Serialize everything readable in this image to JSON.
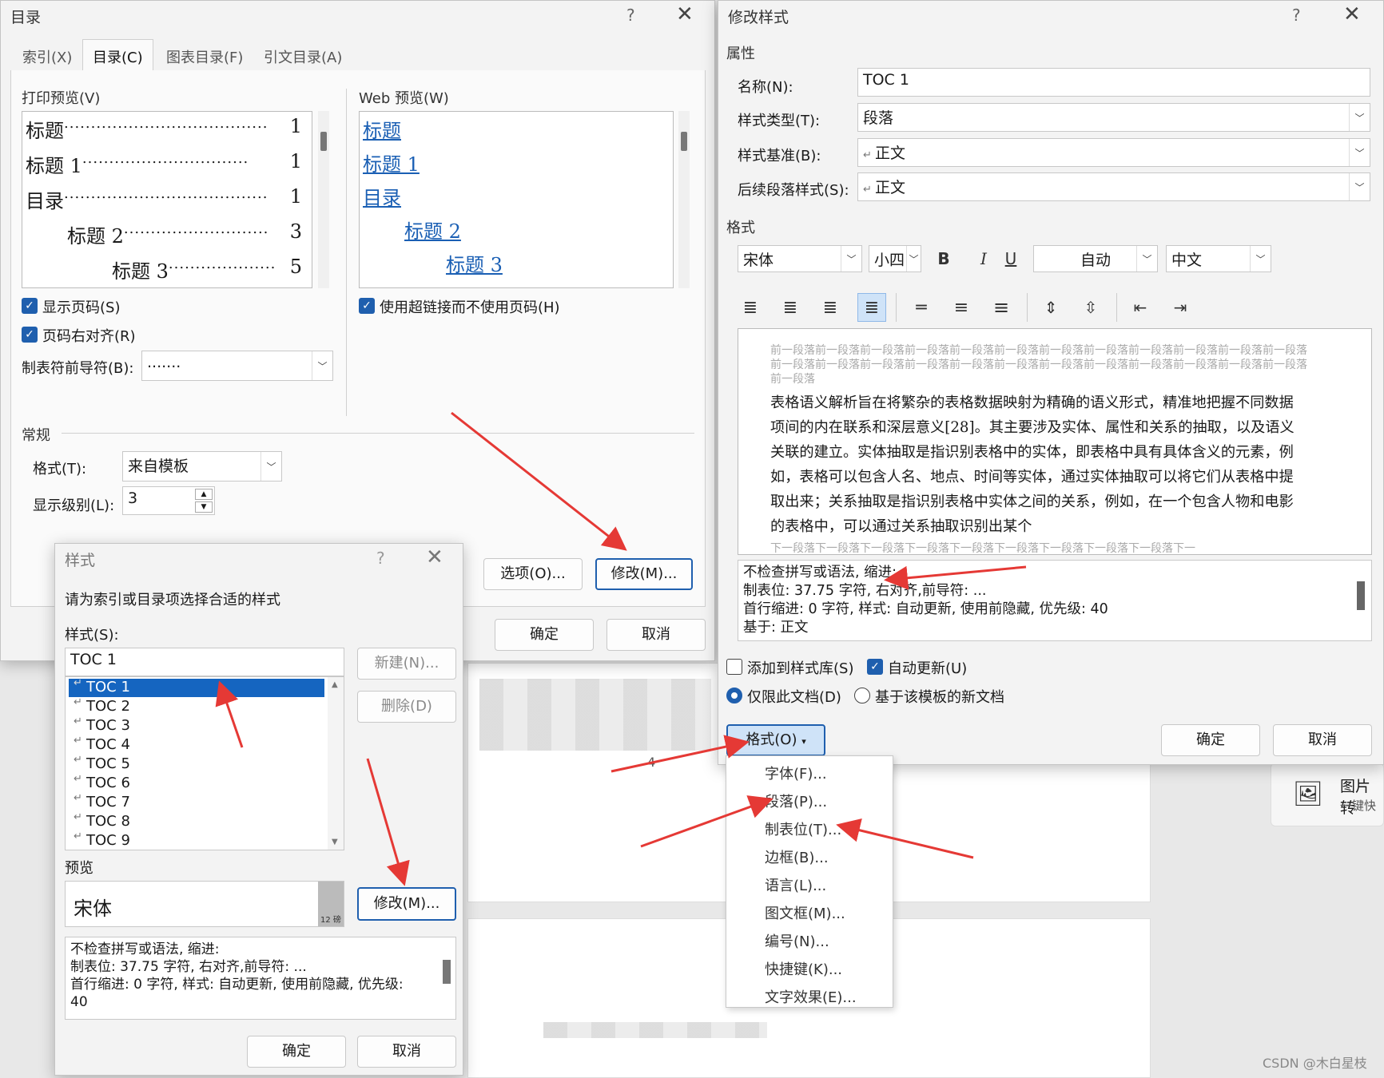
{
  "toc_dialog": {
    "title": "目录",
    "help": "?",
    "close": "✕",
    "tabs": [
      "索引(X)",
      "目录(C)",
      "图表目录(F)",
      "引文目录(A)"
    ],
    "print_preview_label": "打印预览(V)",
    "print_preview_lines": [
      {
        "text": "标题",
        "dots": "......................................",
        "page": "1"
      },
      {
        "text": "标题  1",
        "dots": "...............................",
        "page": "1"
      },
      {
        "text": "目录",
        "dots": "......................................",
        "page": "1"
      },
      {
        "text": "标题  2",
        "dots": "...........................",
        "page": "3"
      },
      {
        "text": "标题  3",
        "dots": "....................",
        "page": "5"
      }
    ],
    "web_preview_label": "Web 预览(W)",
    "web_preview_lines": [
      "标题",
      "标题  1",
      "目录",
      "标题  2",
      "标题  3"
    ],
    "show_page_numbers": "显示页码(S)",
    "right_align": "页码右对齐(R)",
    "tab_leader_label": "制表符前导符(B):",
    "tab_leader_value": ".......",
    "use_hyperlinks": "使用超链接而不使用页码(H)",
    "general_label": "常规",
    "format_label": "格式(T):",
    "format_value": "来自模板",
    "levels_label": "显示级别(L):",
    "levels_value": "3",
    "options_button": "选项(O)...",
    "modify_button": "修改(M)...",
    "ok": "确定",
    "cancel": "取消"
  },
  "style_dialog": {
    "title": "样式",
    "help": "?",
    "close": "✕",
    "instruction": "请为索引或目录项选择合适的样式",
    "styles_label": "样式(S):",
    "style_input": "TOC 1",
    "styles": [
      "TOC 1",
      "TOC 2",
      "TOC 3",
      "TOC 4",
      "TOC 5",
      "TOC 6",
      "TOC 7",
      "TOC 8",
      "TOC 9"
    ],
    "new_button": "新建(N)...",
    "delete_button": "删除(D)",
    "preview_label": "预览",
    "preview_font": "宋体",
    "preview_size": "12 磅",
    "modify_button": "修改(M)...",
    "desc_lines": [
      "不检查拼写或语法, 缩进:",
      "    制表位:  37.75 字符, 右对齐,前导符: ...",
      "    首行缩进:  0 字符, 样式: 自动更新, 使用前隐藏, 优先级:",
      "40"
    ],
    "ok": "确定",
    "cancel": "取消"
  },
  "modify_dialog": {
    "title": "修改样式",
    "help": "?",
    "close": "✕",
    "properties_label": "属性",
    "name_label": "名称(N):",
    "name_value": "TOC 1",
    "type_label": "样式类型(T):",
    "type_value": "段落",
    "based_label": "样式基准(B):",
    "based_value": "正文",
    "next_label": "后续段落样式(S):",
    "next_value": "正文",
    "format_label": "格式",
    "font": "宋体",
    "size": "小四",
    "bold": "B",
    "italic": "I",
    "underline": "U",
    "color": "自动",
    "script": "中文",
    "prev_para": "前一段落前一段落前一段落前一段落前一段落前一段落前一段落前一段落前一段落前一段落前一段落前一段落前一段落前一段落前一段落前一段落前一段落前一段落前一段落前一段落前一段落前一段落前一段落前一段落前一段落",
    "sample_lines": [
      "表格语义解析旨在将繁杂的表格数据映射为精确的语义形式，精准地把握不同数据",
      "项间的内在联系和深层意义[28]。其主要涉及实体、属性和关系的抽取，以及语义",
      "关联的建立。实体抽取是指识别表格中的实体，即表格中具有具体含义的元素，例",
      "如，表格可以包含人名、地点、时间等实体，通过实体抽取可以将它们从表格中提",
      "取出来；关系抽取是指识别表格中实体之间的关系，例如，在一个包含人物和电影",
      "的表格中，可以通过关系抽取识别出某个"
    ],
    "next_para": "下一段落下一段落下一段落下一段落下一段落下一段落下一段落下一段落下一段落下一",
    "desc_lines": [
      "不检查拼写或语法, 缩进:",
      "    制表位:  37.75 字符, 右对齐,前导符: ...",
      "    首行缩进:  0 字符, 样式: 自动更新, 使用前隐藏, 优先级: 40",
      "    基于: 正文"
    ],
    "add_to_gallery": "添加到样式库(S)",
    "auto_update": "自动更新(U)",
    "only_this_doc": "仅限此文档(D)",
    "new_docs": "基于该模板的新文档",
    "format_button": "格式(O)",
    "ok": "确定",
    "cancel": "取消"
  },
  "format_menu": [
    "字体(F)...",
    "段落(P)...",
    "制表位(T)...",
    "边框(B)...",
    "语言(L)...",
    "图文框(M)...",
    "编号(N)...",
    "快捷键(K)...",
    "文字效果(E)..."
  ],
  "side_panel": {
    "title": "图片转",
    "subtitle": "一键快"
  },
  "doc_page_num": "4",
  "watermark": "CSDN @木白星枝"
}
